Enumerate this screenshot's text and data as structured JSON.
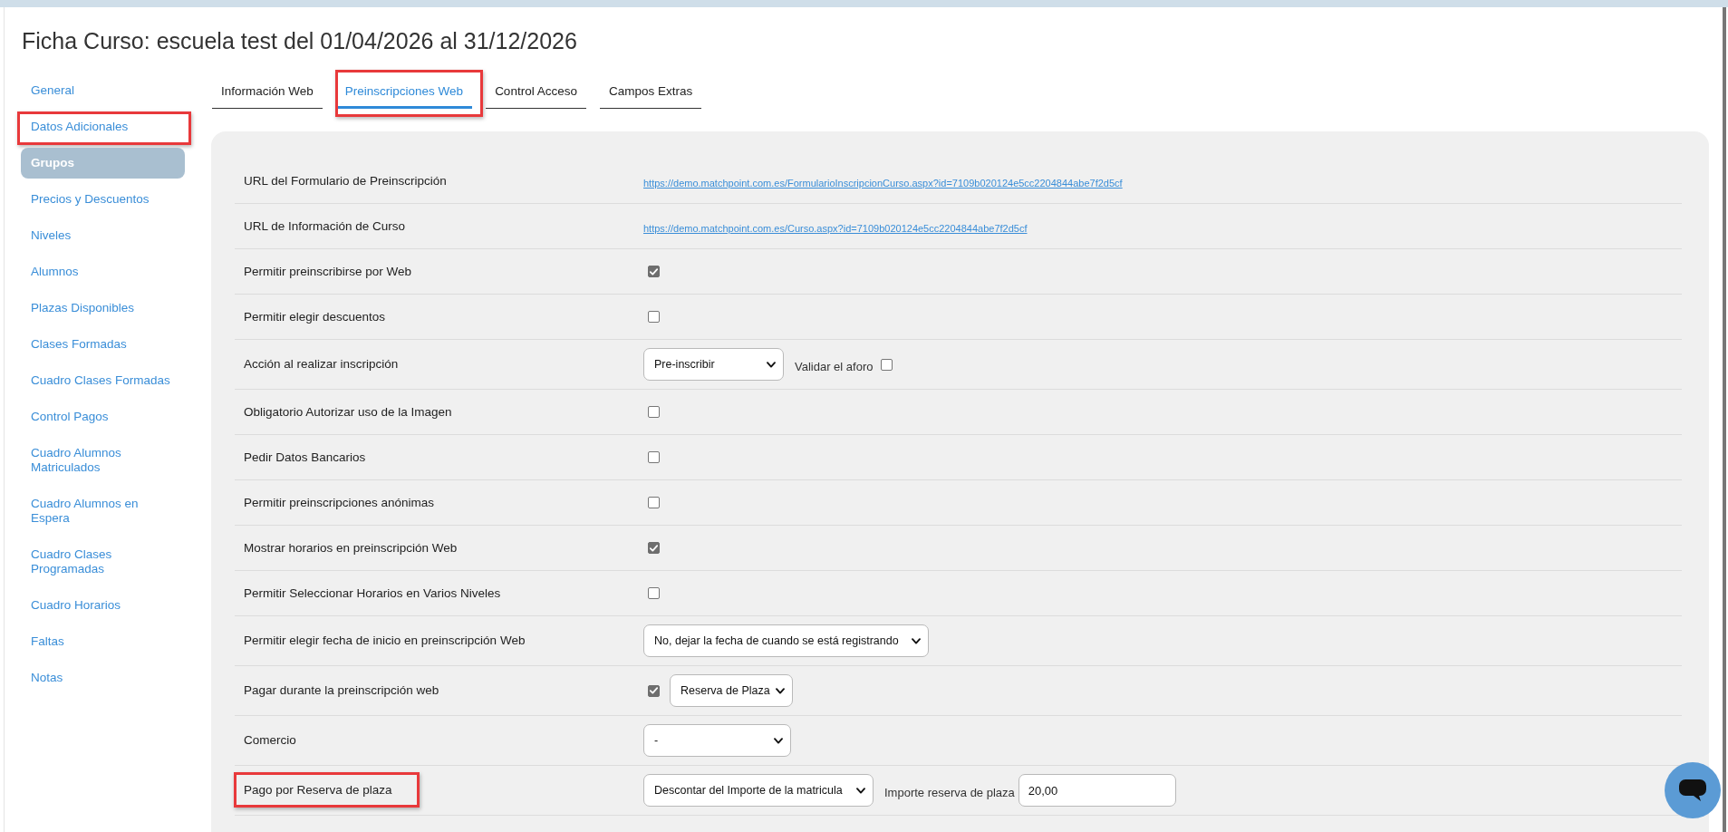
{
  "page": {
    "title": "Ficha Curso: escuela test del 01/04/2026 al 31/12/2026"
  },
  "sidebar": {
    "items": [
      {
        "label": "General",
        "selected": false,
        "highlighted": false
      },
      {
        "label": "Datos Adicionales",
        "selected": false,
        "highlighted": true
      },
      {
        "label": "Grupos",
        "selected": true,
        "highlighted": false
      },
      {
        "label": "Precios y Descuentos",
        "selected": false,
        "highlighted": false
      },
      {
        "label": "Niveles",
        "selected": false,
        "highlighted": false
      },
      {
        "label": "Alumnos",
        "selected": false,
        "highlighted": false
      },
      {
        "label": "Plazas Disponibles",
        "selected": false,
        "highlighted": false
      },
      {
        "label": "Clases Formadas",
        "selected": false,
        "highlighted": false
      },
      {
        "label": "Cuadro Clases Formadas",
        "selected": false,
        "highlighted": false
      },
      {
        "label": "Control Pagos",
        "selected": false,
        "highlighted": false
      },
      {
        "label": "Cuadro Alumnos Matriculados",
        "selected": false,
        "highlighted": false
      },
      {
        "label": "Cuadro Alumnos en Espera",
        "selected": false,
        "highlighted": false
      },
      {
        "label": "Cuadro Clases Programadas",
        "selected": false,
        "highlighted": false
      },
      {
        "label": "Cuadro Horarios",
        "selected": false,
        "highlighted": false
      },
      {
        "label": "Faltas",
        "selected": false,
        "highlighted": false
      },
      {
        "label": "Notas",
        "selected": false,
        "highlighted": false
      }
    ]
  },
  "tabs": [
    {
      "label": "Información Web",
      "selected": false,
      "highlighted": false
    },
    {
      "label": "Preinscripciones Web",
      "selected": true,
      "highlighted": true
    },
    {
      "label": "Control Acceso",
      "selected": false,
      "highlighted": false
    },
    {
      "label": "Campos Extras",
      "selected": false,
      "highlighted": false
    }
  ],
  "rows": [
    {
      "label": "URL del Formulario de Preinscripción",
      "highlighted": false,
      "controls": [
        {
          "kind": "link",
          "text": "https://demo.matchpoint.com.es/FormularioInscripcionCurso.aspx?id=7109b020124e5cc2204844abe7f2d5cf"
        }
      ]
    },
    {
      "label": "URL de Información de Curso",
      "highlighted": false,
      "controls": [
        {
          "kind": "link",
          "text": "https://demo.matchpoint.com.es/Curso.aspx?id=7109b020124e5cc2204844abe7f2d5cf"
        }
      ]
    },
    {
      "label": "Permitir preinscribirse por Web",
      "highlighted": false,
      "controls": [
        {
          "kind": "checkbox",
          "checked": true
        }
      ]
    },
    {
      "label": "Permitir elegir descuentos",
      "highlighted": false,
      "controls": [
        {
          "kind": "checkbox",
          "checked": false
        }
      ]
    },
    {
      "label": "Acción al realizar inscripción",
      "highlighted": false,
      "controls": [
        {
          "kind": "select",
          "value": "Pre-inscribir"
        },
        {
          "kind": "text",
          "text": "Validar el aforo"
        },
        {
          "kind": "checkbox",
          "checked": false
        }
      ]
    },
    {
      "label": "Obligatorio Autorizar uso de la Imagen",
      "highlighted": false,
      "controls": [
        {
          "kind": "checkbox",
          "checked": false
        }
      ]
    },
    {
      "label": "Pedir Datos Bancarios",
      "highlighted": false,
      "controls": [
        {
          "kind": "checkbox",
          "checked": false
        }
      ]
    },
    {
      "label": "Permitir preinscripciones anónimas",
      "highlighted": false,
      "controls": [
        {
          "kind": "checkbox",
          "checked": false
        }
      ]
    },
    {
      "label": "Mostrar horarios en preinscripción Web",
      "highlighted": false,
      "controls": [
        {
          "kind": "checkbox",
          "checked": true
        }
      ]
    },
    {
      "label": "Permitir Seleccionar Horarios en Varios Niveles",
      "highlighted": false,
      "controls": [
        {
          "kind": "checkbox",
          "checked": false
        }
      ]
    },
    {
      "label": "Permitir elegir fecha de inicio en preinscripción Web",
      "highlighted": false,
      "controls": [
        {
          "kind": "select",
          "value": "No, dejar la fecha de cuando se está registrando"
        }
      ]
    },
    {
      "label": "Pagar durante la preinscripción web",
      "highlighted": false,
      "controls": [
        {
          "kind": "checkbox",
          "checked": true
        },
        {
          "kind": "select",
          "value": "Reserva de Plaza"
        }
      ]
    },
    {
      "label": "Comercio",
      "highlighted": false,
      "controls": [
        {
          "kind": "select",
          "value": "-"
        }
      ]
    },
    {
      "label": "Pago por Reserva de plaza",
      "highlighted": true,
      "controls": [
        {
          "kind": "select",
          "value": "Descontar del Importe de la matricula"
        },
        {
          "kind": "text",
          "text": "Importe reserva de plaza"
        },
        {
          "kind": "input",
          "value": "20,00"
        }
      ]
    }
  ]
}
